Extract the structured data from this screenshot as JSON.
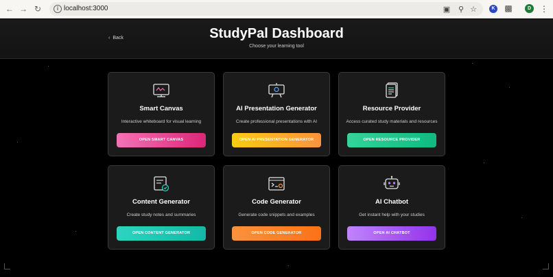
{
  "browser": {
    "url": "localhost:3000",
    "profile_initial": "D",
    "extension_initial": "K"
  },
  "header": {
    "back_label": "Back",
    "title": "StudyPal Dashboard",
    "subtitle": "Choose your learning tool"
  },
  "cards": [
    {
      "title": "Smart Canvas",
      "description": "Interactive whiteboard for visual learning",
      "button": "OPEN SMART CANVAS",
      "gradient": [
        "#f472b6",
        "#db2777"
      ],
      "icon": "whiteboard-icon"
    },
    {
      "title": "AI Presentation Generator",
      "description": "Create professional presentations with AI",
      "button": "OPEN AI PRESENTATION GENERATOR",
      "gradient": [
        "#facc15",
        "#fb923c"
      ],
      "icon": "projector-icon"
    },
    {
      "title": "Resource Provider",
      "description": "Access curated study materials and resources",
      "button": "OPEN RESOURCE PROVIDER",
      "gradient": [
        "#34d399",
        "#10b981"
      ],
      "icon": "document-stack-icon"
    },
    {
      "title": "Content Generator",
      "description": "Create study notes and summaries",
      "button": "OPEN CONTENT GENERATOR",
      "gradient": [
        "#2dd4bf",
        "#14b8a6"
      ],
      "icon": "notes-check-icon"
    },
    {
      "title": "Code Generator",
      "description": "Generate code snippets and examples",
      "button": "OPEN CODE GENERATOR",
      "gradient": [
        "#fb923c",
        "#f97316"
      ],
      "icon": "code-window-icon"
    },
    {
      "title": "AI Chatbot",
      "description": "Get instant help with your studies",
      "button": "OPEN AI CHATBOT",
      "gradient": [
        "#c084fc",
        "#9333ea"
      ],
      "icon": "robot-icon"
    }
  ]
}
